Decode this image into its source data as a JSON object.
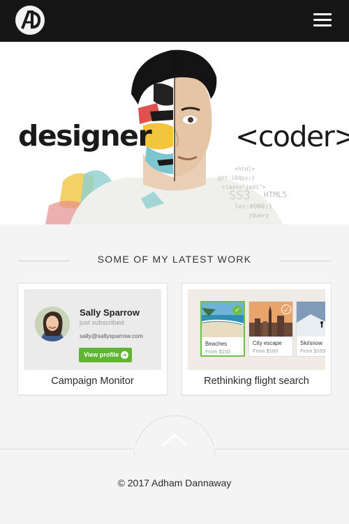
{
  "header": {
    "logo_icon": "ad-monogram-logo-icon",
    "menu_icon": "hamburger-menu-icon"
  },
  "hero": {
    "left_word": "designer",
    "right_word": "<coder>",
    "code_snippets": [
      "<html>",
      "ght:184px;}",
      "class=\"jedi\">",
      "SS3",
      "HTML5",
      "lor:#000;}",
      "jQuery"
    ]
  },
  "section": {
    "title": "SOME OF MY LATEST WORK"
  },
  "cards": [
    {
      "caption": "Campaign Monitor",
      "profile": {
        "name": "Sally Sparrow",
        "status": "just subscribed",
        "email": "sally@sallysparrow.com",
        "button_label": "View profile",
        "button_icon": "arrow-right-circle-icon"
      }
    },
    {
      "caption": "Rethinking flight search",
      "options": [
        {
          "name": "Beaches",
          "price": "From $150",
          "selected": true
        },
        {
          "name": "City escape",
          "price": "From $160",
          "selected": false
        },
        {
          "name": "Ski/snow",
          "price": "From $165",
          "selected": false
        }
      ]
    }
  ],
  "scroll_top_icon": "chevron-up-icon",
  "footer": {
    "copyright": "© 2017 Adham Dannaway"
  },
  "colors": {
    "header_bg": "#161616",
    "accent_green": "#5fb531",
    "page_bg": "#f4f4f4"
  }
}
